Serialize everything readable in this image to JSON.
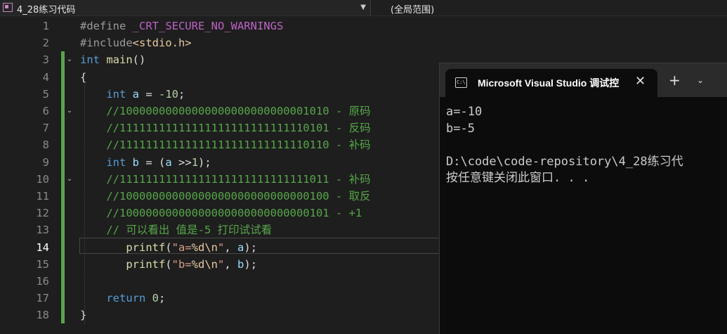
{
  "navbar": {
    "file": "4_28练习代码",
    "scope": "(全局范围)"
  },
  "editor": {
    "line_numbers": [
      "1",
      "2",
      "3",
      "4",
      "5",
      "6",
      "7",
      "8",
      "9",
      "10",
      "11",
      "12",
      "13",
      "14",
      "15",
      "16",
      "17",
      "18"
    ],
    "active_line": "14",
    "lines": [
      {
        "t": [
          [
            "pp",
            "#define "
          ],
          [
            "macro",
            "_CRT_SECURE_NO_WARNINGS"
          ]
        ]
      },
      {
        "t": [
          [
            "pp",
            "#include"
          ],
          [
            "inc",
            "<stdio.h>"
          ]
        ]
      },
      {
        "t": [
          [
            "kw",
            "int"
          ],
          [
            "",
            " "
          ],
          [
            "fn",
            "main"
          ],
          [
            "",
            "()"
          ]
        ]
      },
      {
        "t": [
          [
            "",
            "{"
          ]
        ]
      },
      {
        "t": [
          [
            "",
            "    "
          ],
          [
            "kw",
            "int"
          ],
          [
            "",
            " "
          ],
          [
            "var",
            "a"
          ],
          [
            "",
            " = "
          ],
          [
            "num",
            "-10"
          ],
          [
            "",
            ";"
          ]
        ]
      },
      {
        "t": [
          [
            "",
            "    "
          ],
          [
            "cm",
            "//10000000000000000000000000001010 - 原码"
          ]
        ]
      },
      {
        "t": [
          [
            "",
            "    "
          ],
          [
            "cm",
            "//11111111111111111111111111110101 - 反码"
          ]
        ]
      },
      {
        "t": [
          [
            "",
            "    "
          ],
          [
            "cm",
            "//11111111111111111111111111110110 - 补码"
          ]
        ]
      },
      {
        "t": [
          [
            "",
            "    "
          ],
          [
            "kw",
            "int"
          ],
          [
            "",
            " "
          ],
          [
            "var",
            "b"
          ],
          [
            "",
            " = ("
          ],
          [
            "var",
            "a"
          ],
          [
            "",
            " >>"
          ],
          [
            "num",
            "1"
          ],
          [
            "",
            ");"
          ]
        ]
      },
      {
        "t": [
          [
            "",
            "    "
          ],
          [
            "cm",
            "//11111111111111111111111111111011 - 补码"
          ]
        ]
      },
      {
        "t": [
          [
            "",
            "    "
          ],
          [
            "cm",
            "//10000000000000000000000000000100 - 取反"
          ]
        ]
      },
      {
        "t": [
          [
            "",
            "    "
          ],
          [
            "cm",
            "//10000000000000000000000000000101 - +1"
          ]
        ]
      },
      {
        "t": [
          [
            "",
            "    "
          ],
          [
            "cm",
            "// 可以看出 值是-5 打印试试看"
          ]
        ]
      },
      {
        "t": [
          [
            "",
            "       "
          ],
          [
            "fn",
            "printf"
          ],
          [
            "",
            "("
          ],
          [
            "str",
            "\"a="
          ],
          [
            "esc",
            "%d\\n"
          ],
          [
            "str",
            "\""
          ],
          [
            "",
            ", "
          ],
          [
            "var",
            "a"
          ],
          [
            "",
            ");"
          ]
        ]
      },
      {
        "t": [
          [
            "",
            "       "
          ],
          [
            "fn",
            "printf"
          ],
          [
            "",
            "("
          ],
          [
            "str",
            "\"b="
          ],
          [
            "esc",
            "%d\\n"
          ],
          [
            "str",
            "\""
          ],
          [
            "",
            ", "
          ],
          [
            "var",
            "b"
          ],
          [
            "",
            ");"
          ]
        ]
      },
      {
        "t": [
          [
            "",
            ""
          ]
        ]
      },
      {
        "t": [
          [
            "",
            "    "
          ],
          [
            "kw",
            "return"
          ],
          [
            "",
            " "
          ],
          [
            "num",
            "0"
          ],
          [
            "",
            ";"
          ]
        ]
      },
      {
        "t": [
          [
            "",
            "}"
          ]
        ]
      }
    ],
    "fold_lines": [
      3,
      6,
      10
    ]
  },
  "console": {
    "title": "Microsoft Visual Studio 调试控",
    "icon_text": "C:\\",
    "close_glyph": "✕",
    "new_tab_glyph": "+",
    "dropdown_glyph": "⌄",
    "output": [
      "a=-10",
      "b=-5",
      "",
      "D:\\code\\code-repository\\4_28练习代",
      "按任意键关闭此窗口. . ."
    ]
  },
  "colors": {
    "editor_bg": "#1e1e1e",
    "keyword": "#569cd6",
    "comment": "#57a64a",
    "string": "#d69d85",
    "function": "#dcdcaa",
    "variable": "#9cdcfe",
    "number": "#b5cea8",
    "console_bg": "#0c0c0c"
  }
}
